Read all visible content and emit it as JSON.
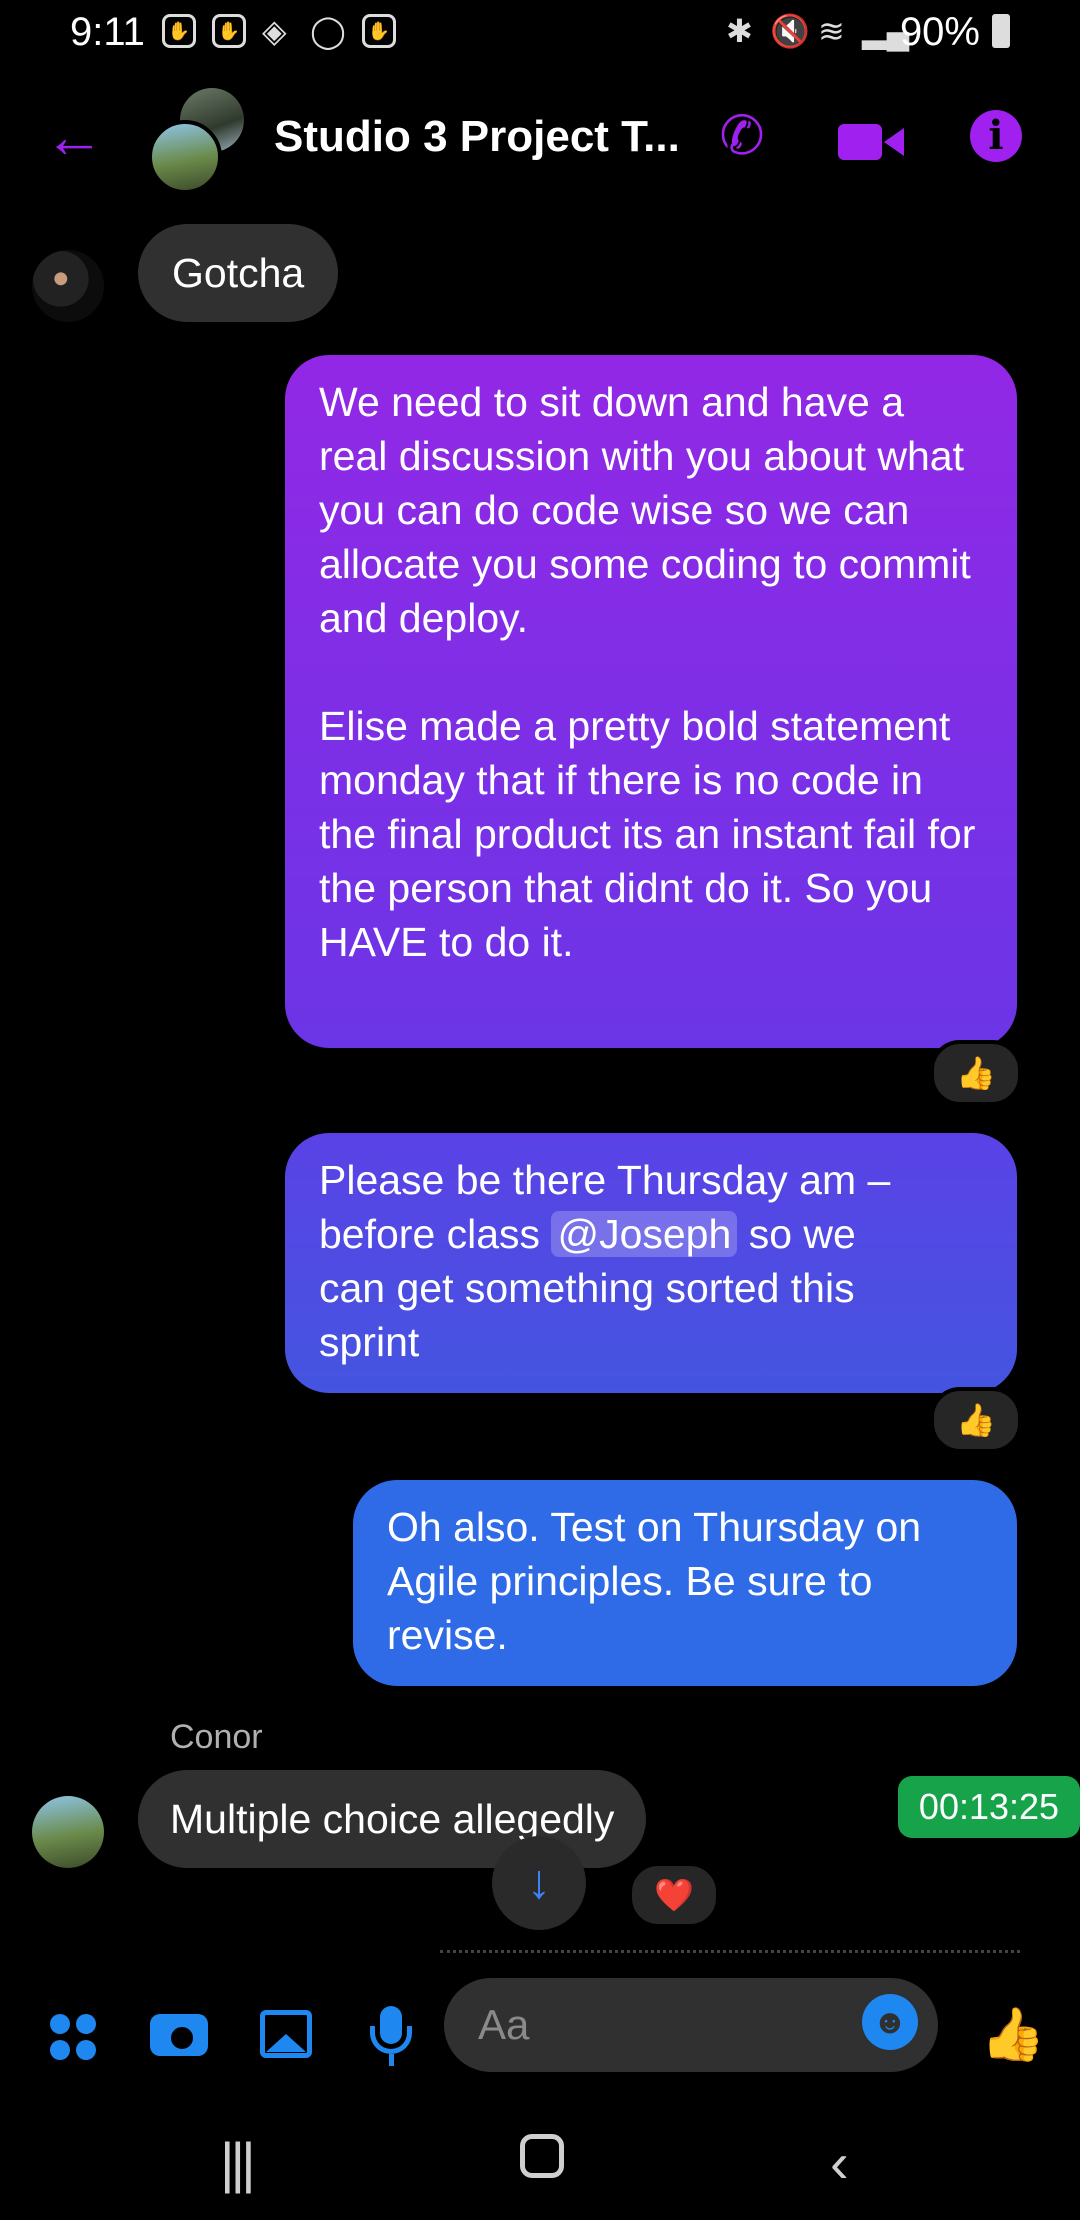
{
  "status_bar": {
    "time": "9:11",
    "battery": "90%"
  },
  "header": {
    "title": "Studio 3 Project T...",
    "back_icon": "arrow-left-icon",
    "call_icon": "phone-icon",
    "video_icon": "video-camera-icon",
    "info_icon": "info-icon",
    "accent_color": "#a020f0"
  },
  "messages": [
    {
      "direction": "incoming",
      "text": "Gotcha"
    },
    {
      "direction": "outgoing",
      "text": "We need to sit down and have a real discussion with you about what you can do code wise so we can allocate you some coding to commit and deploy.\n\nElise made a pretty bold statement monday that if there is no code in the final product its an instant fail for the person that didnt do it. So you HAVE to do it.",
      "reaction": "👍"
    },
    {
      "direction": "outgoing",
      "text_before": "Please be there  Thursday am –\nbefore class ",
      "mention": "@Joseph",
      "text_after": " so we\ncan get something sorted this\nsprint",
      "reaction": "👍"
    },
    {
      "direction": "outgoing",
      "text": "Oh also. Test on Thursday on Agile principles. Be sure to revise."
    },
    {
      "direction": "incoming",
      "sender": "Conor",
      "text": "Multiple choice allegedly",
      "reaction": "❤️"
    }
  ],
  "timer_overlay": "00:13:25",
  "composer": {
    "placeholder": "Aa",
    "accent_color": "#1e88f0"
  }
}
